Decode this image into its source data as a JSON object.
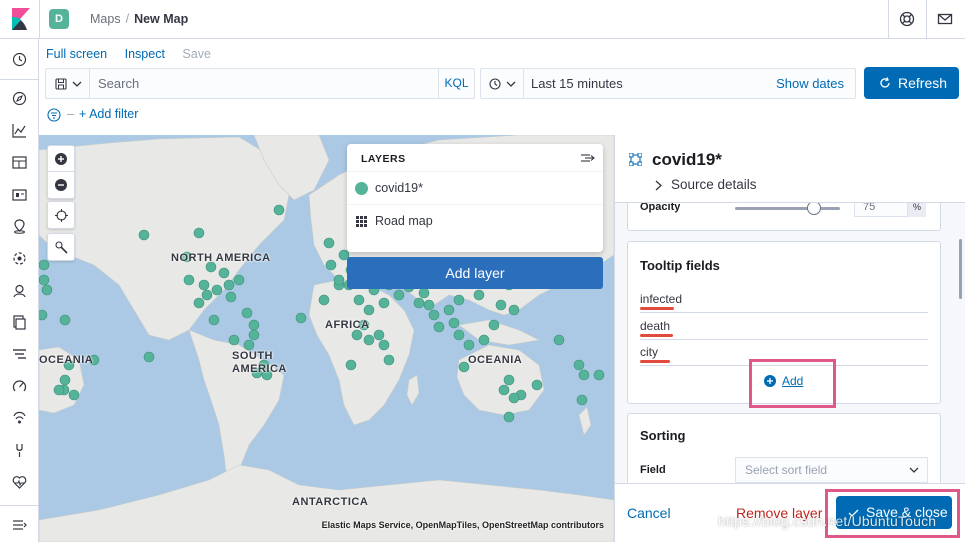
{
  "header": {
    "space_initial": "D",
    "breadcrumbs": [
      "Maps",
      "New Map"
    ],
    "icons": [
      "kibana-logo-icon",
      "help-icon",
      "mail-icon"
    ]
  },
  "leftnav": {
    "icons": [
      "clock-icon",
      "discover-icon",
      "visualize-icon",
      "dashboard-icon",
      "canvas-icon",
      "maps-icon",
      "ml-icon",
      "infrastructure-icon",
      "logs-icon",
      "apm-icon",
      "uptime-icon",
      "siem-icon",
      "dev-tools-icon",
      "monitoring-icon",
      "management-icon",
      "collapse-nav-icon"
    ]
  },
  "menu": {
    "full_screen": "Full screen",
    "inspect": "Inspect",
    "save": "Save"
  },
  "query": {
    "placeholder": "Search",
    "language": "KQL"
  },
  "time": {
    "range": "Last 15 minutes",
    "show_dates": "Show dates",
    "refresh": "Refresh"
  },
  "filters": {
    "add_filter": "+ Add filter"
  },
  "map": {
    "labels": {
      "north_america": "NORTH AMERICA",
      "south_america": "SOUTH AMERICA",
      "africa": "AFRICA",
      "oceania_left": "OCEANIA",
      "oceania_right": "OCEANIA",
      "antarctica": "ANTARCTICA"
    },
    "attribution": "Elastic Maps Service, OpenMapTiles, OpenStreetMap contributors",
    "point_color": "#54b399",
    "land_color": "#e8e9e6",
    "water_color": "#abc9e5"
  },
  "layers_panel": {
    "title": "LAYERS",
    "layers": [
      {
        "name": "covid19*",
        "swatch": "#54b399"
      },
      {
        "name": "Road map"
      }
    ],
    "add_layer": "Add layer"
  },
  "details": {
    "layer_name": "covid19*",
    "source_details": "Source details",
    "opacity_label": "Opacity",
    "opacity_value": "75",
    "opacity_unit": "%",
    "opacity_level": 0.75,
    "tooltip_title": "Tooltip fields",
    "tooltip_fields": [
      "infected",
      "death",
      "city"
    ],
    "add": "Add",
    "sorting_title": "Sorting",
    "field_label": "Field",
    "sort_placeholder": "Select sort field",
    "cancel": "Cancel",
    "remove_layer": "Remove layer",
    "save_close": "Save & close",
    "danger_color": "#bd271e",
    "highlight_color": "#e0578a"
  },
  "watermark": "https://blog.csdn.net/UbuntuTouch"
}
